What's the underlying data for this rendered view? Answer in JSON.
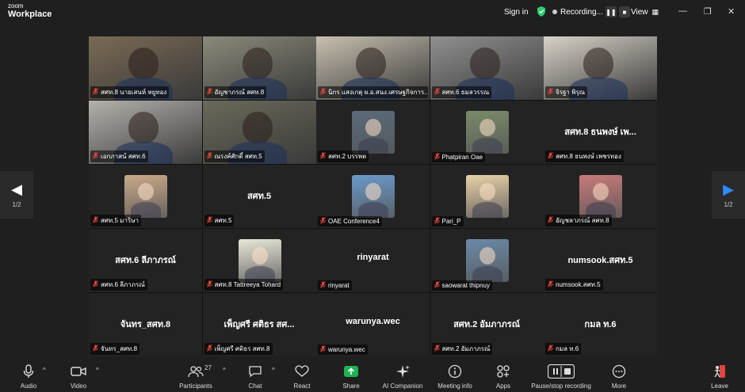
{
  "app": {
    "logo_top": "zoom",
    "logo_bottom": "Workplace"
  },
  "topbar": {
    "sign_in": "Sign in",
    "recording": "Recording...",
    "view": "View"
  },
  "pagination": {
    "left_page": "1/2",
    "right_page": "1/2"
  },
  "tiles": [
    {
      "name": "สศท.8 นายเสนห์ หยูทอง",
      "big": "",
      "type": "video",
      "active": true,
      "color": "#7a6a55"
    },
    {
      "name": "อัญชาภรณ์ สศท.8",
      "big": "",
      "type": "video",
      "color": "#8a8a7a"
    },
    {
      "name": "นิกร แสงเกตุ ผ.อ.สนง.เศรษฐกิจการ...",
      "big": "",
      "type": "video",
      "color": "#c8c0b0"
    },
    {
      "name": "สศท.6 ธมลวรรณ",
      "big": "",
      "type": "video",
      "color": "#909090"
    },
    {
      "name": "จิรฐา พิรุณ",
      "big": "",
      "type": "video",
      "color": "#d8d2c8"
    },
    {
      "name": "เอกภาสน์ สศท.6",
      "big": "",
      "type": "video",
      "color": "#b5b2ad"
    },
    {
      "name": "ณรงค์ศักดิ์ สศท.5",
      "big": "",
      "type": "video",
      "color": "#6a6a5a"
    },
    {
      "name": "สศท.2 บรรพต",
      "big": "",
      "type": "avatar",
      "color": "#5a6a7a"
    },
    {
      "name": "Phatpiran Oae",
      "big": "",
      "type": "avatar",
      "color": "#7a8a6a"
    },
    {
      "name": "สศท.8 ธนพงษ์ เพชรทอง",
      "big": "สศท.8 ธนพงษ์ เพ...",
      "type": "text"
    },
    {
      "name": "สศท.5 มาริษา",
      "big": "",
      "type": "avatar",
      "color": "#c9a98a"
    },
    {
      "name": "สศท.5",
      "big": "สศท.5",
      "type": "text"
    },
    {
      "name": "OAE Conference4",
      "big": "",
      "type": "avatar",
      "color": "#6a9ac9"
    },
    {
      "name": "Pari_P",
      "big": "",
      "type": "avatar",
      "color": "#e8d2a8"
    },
    {
      "name": "อัญชลาภรณ์ สศท.8",
      "big": "",
      "type": "avatar",
      "color": "#c87a7a"
    },
    {
      "name": "สศท.6 ลีภาภรณ์",
      "big": "สศท.6 ลีภาภรณ์",
      "type": "text"
    },
    {
      "name": "สศท.8 Tattreeya Tohard",
      "big": "",
      "type": "avatar",
      "color": "#e8e8d8"
    },
    {
      "name": "rinyarat",
      "big": "rinyarat",
      "type": "text"
    },
    {
      "name": "saowarat thipnuy",
      "big": "",
      "type": "avatar",
      "color": "#6a8aa8"
    },
    {
      "name": "numsook.สศท.5",
      "big": "numsook.สศท.5",
      "type": "text"
    },
    {
      "name": "จันทร_สศท.8",
      "big": "จันทร_สศท.8",
      "type": "text"
    },
    {
      "name": "เพ็ญศรี ศติธร สศท.8",
      "big": "เพ็ญศรี ศติธร สศ...",
      "type": "text"
    },
    {
      "name": "warunya.wec",
      "big": "warunya.wec",
      "type": "text"
    },
    {
      "name": "สศท.2 อัมภาภรณ์",
      "big": "สศท.2 อัมภาภรณ์",
      "type": "text"
    },
    {
      "name": "กมล ท.6",
      "big": "กมล ท.6",
      "type": "text"
    }
  ],
  "toolbar": {
    "audio": "Audio",
    "video": "Video",
    "participants": "Participants",
    "participants_count": "27",
    "chat": "Chat",
    "react": "React",
    "share": "Share",
    "ai": "AI Companion",
    "meeting_info": "Meeting info",
    "apps": "Apps",
    "pause_stop": "Pause/stop recording",
    "more": "More",
    "leave": "Leave"
  },
  "colors": {
    "accent_green": "#2ecc71",
    "share_green": "#1fb255",
    "leave_red": "#e0443e",
    "nav_blue": "#2d8cff"
  }
}
